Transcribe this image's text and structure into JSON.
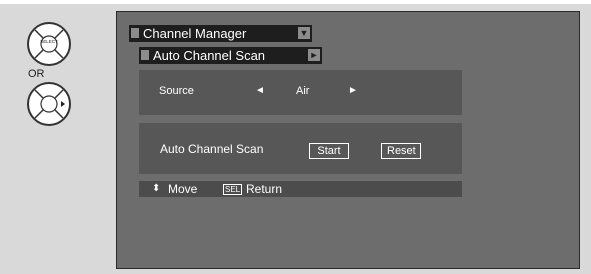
{
  "remote": {
    "select_label": "SELECT",
    "or_label": "OR"
  },
  "menu": {
    "title": "Channel Manager",
    "submenu_title": "Auto Channel Scan",
    "source": {
      "label": "Source",
      "value": "Air",
      "left_arrow": "◄",
      "right_arrow": "►"
    },
    "scan": {
      "label": "Auto Channel Scan",
      "start_label": "Start",
      "reset_label": "Reset"
    },
    "footer": {
      "move_icon": "⬍",
      "move_label": "Move",
      "sel_icon": "SEL",
      "return_label": "Return"
    }
  },
  "colors": {
    "screen": "#6d6d6d",
    "section": "#575757",
    "title_bar": "#1e1e1e"
  }
}
